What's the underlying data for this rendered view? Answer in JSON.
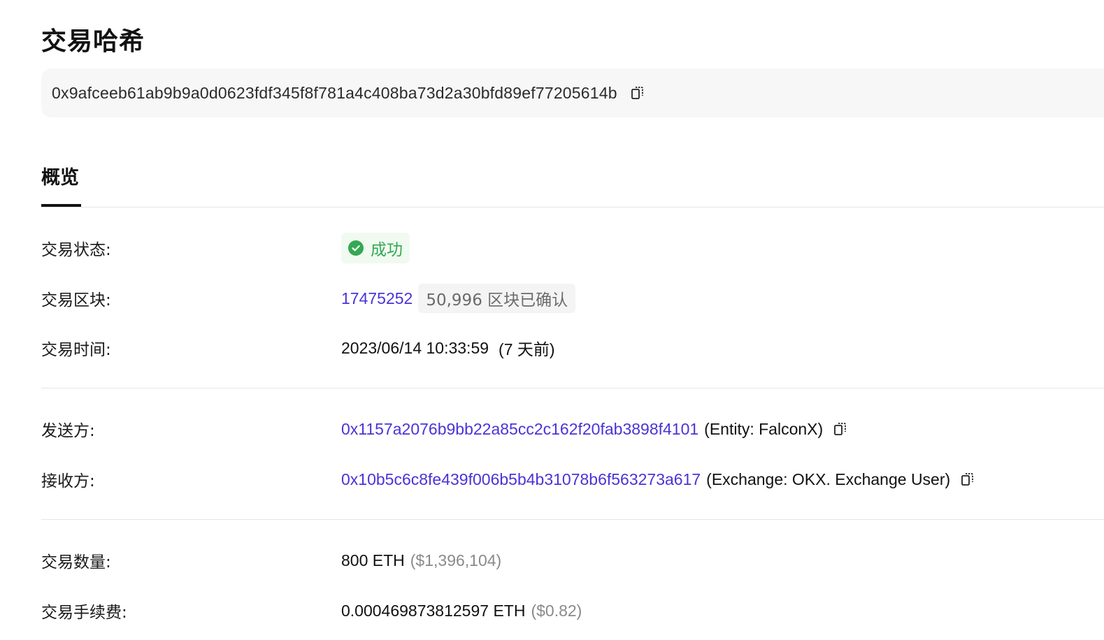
{
  "title": "交易哈希",
  "hash": {
    "value": "0x9afceeb61ab9b9a0d0623fdf345f8f781a4c408ba73d2a30bfd89ef77205614b",
    "copy_icon": "copy-icon"
  },
  "tabs": [
    {
      "label": "概览",
      "active": true
    }
  ],
  "rows": {
    "status": {
      "label": "交易状态:",
      "value": "成功",
      "icon": "check-circle-icon",
      "color": "#34a853"
    },
    "block": {
      "label": "交易区块:",
      "number": "17475252",
      "confirmations": "50,996 区块已确认"
    },
    "time": {
      "label": "交易时间:",
      "value": "2023/06/14 10:33:59",
      "relative": "(7 天前)"
    },
    "from": {
      "label": "发送方:",
      "address": "0x1157a2076b9bb22a85cc2c162f20fab3898f4101",
      "tag": "(Entity: FalconX)"
    },
    "to": {
      "label": "接收方:",
      "address": "0x10b5c6c8fe439f006b5b4b31078b6f563273a617",
      "tag": "(Exchange: OKX. Exchange User)"
    },
    "amount": {
      "label": "交易数量:",
      "value": "800 ETH",
      "usd": "($1,396,104)"
    },
    "fee": {
      "label": "交易手续费:",
      "value": "0.000469873812597 ETH",
      "usd": "($0.82)"
    }
  },
  "colors": {
    "link": "#4a34d6",
    "success": "#34a853",
    "muted": "#8a8a8a"
  }
}
